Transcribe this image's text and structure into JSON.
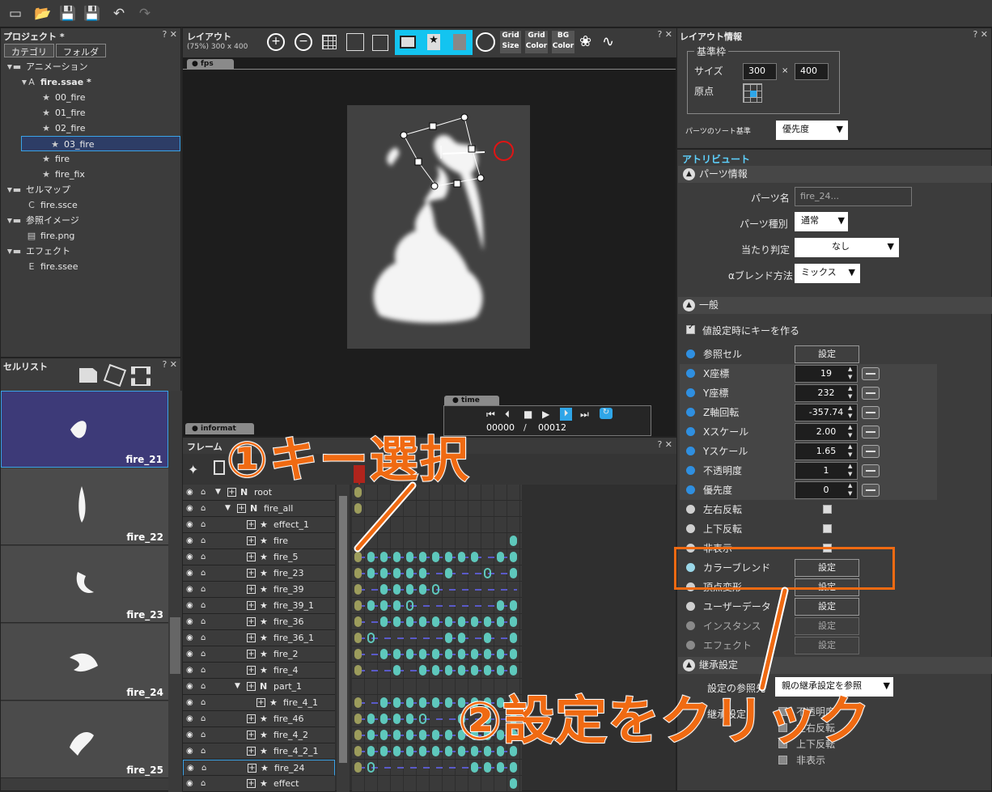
{
  "project": {
    "title": "プロジェクト *",
    "tabs": [
      "カテゴリ",
      "フォルダ"
    ],
    "tree": [
      {
        "label": "アニメーション",
        "icon": "folder-icon",
        "indent": 0,
        "expander": "▲"
      },
      {
        "label": "fire.ssae *",
        "icon": "animation-file-icon",
        "indent": 1,
        "expander": "▲"
      },
      {
        "label": "00_fire",
        "icon": "running-figure-icon",
        "indent": 2
      },
      {
        "label": "01_fire",
        "icon": "running-figure-icon",
        "indent": 2
      },
      {
        "label": "02_fire",
        "icon": "running-figure-icon",
        "indent": 2
      },
      {
        "label": "03_fire",
        "icon": "running-figure-icon",
        "indent": 2,
        "selected": true
      },
      {
        "label": "fire",
        "icon": "running-figure-icon",
        "indent": 2
      },
      {
        "label": "fire_fix",
        "icon": "running-figure-icon",
        "indent": 2
      },
      {
        "label": "セルマップ",
        "icon": "folder-icon",
        "indent": 0,
        "expander": "▲"
      },
      {
        "label": "fire.ssce",
        "icon": "cellmap-file-icon",
        "indent": 1
      },
      {
        "label": "参照イメージ",
        "icon": "folder-icon",
        "indent": 0,
        "expander": "▲"
      },
      {
        "label": "fire.png",
        "icon": "image-file-icon",
        "indent": 1
      },
      {
        "label": "エフェクト",
        "icon": "folder-icon",
        "indent": 0,
        "expander": "▲"
      },
      {
        "label": "fire.ssee",
        "icon": "effect-file-icon",
        "indent": 1
      }
    ]
  },
  "cell_list": {
    "title": "セルリスト",
    "cells": [
      "fire_21",
      "fire_22",
      "fire_23",
      "fire_24",
      "fire_25"
    ]
  },
  "layout": {
    "title": "レイアウト",
    "subtitle": "(75%) 300 x 400",
    "fps_label": "fps",
    "time_label": "time",
    "info_label": "informat",
    "tools": [
      "Grid Size",
      "Grid Color",
      "BG Color"
    ],
    "frame_current": "00000",
    "frame_sep": "/",
    "frame_total": "00012"
  },
  "timeline": {
    "title": "フレーム",
    "rows": [
      {
        "name": "root",
        "type": "N",
        "indent": 0,
        "keys": [
          0
        ]
      },
      {
        "name": "fire_all",
        "type": "N",
        "indent": 1,
        "keys": [
          0
        ]
      },
      {
        "name": "effect_1",
        "type": "effect",
        "indent": 2,
        "keys": []
      },
      {
        "name": "fire",
        "type": "part",
        "indent": 2,
        "keys": [
          12
        ]
      },
      {
        "name": "fire_5",
        "type": "part",
        "indent": 2,
        "keys": [
          0,
          1,
          2,
          3,
          4,
          5,
          6,
          7,
          8,
          9,
          11,
          12
        ]
      },
      {
        "name": "fire_23",
        "type": "part",
        "indent": 2,
        "keys": [
          0,
          1,
          2,
          3,
          4,
          5,
          7,
          10,
          12
        ]
      },
      {
        "name": "fire_39",
        "type": "part",
        "indent": 2,
        "keys": [
          0,
          2,
          3,
          4,
          5,
          6
        ]
      },
      {
        "name": "fire_39_1",
        "type": "part",
        "indent": 2,
        "keys": [
          0,
          1,
          2,
          3,
          4,
          11,
          12
        ]
      },
      {
        "name": "fire_36",
        "type": "part",
        "indent": 2,
        "keys": [
          0,
          2,
          3,
          4,
          5,
          6,
          7,
          8,
          9,
          10,
          11,
          12
        ]
      },
      {
        "name": "fire_36_1",
        "type": "part",
        "indent": 2,
        "keys": [
          0,
          1,
          7,
          8,
          10,
          12
        ]
      },
      {
        "name": "fire_2",
        "type": "part",
        "indent": 2,
        "keys": [
          0,
          2,
          3,
          4,
          5,
          6,
          7,
          8,
          9,
          10,
          11,
          12
        ]
      },
      {
        "name": "fire_4",
        "type": "part",
        "indent": 2,
        "keys": [
          0,
          3,
          5,
          6,
          7,
          8,
          9,
          10,
          11,
          12
        ]
      },
      {
        "name": "part_1",
        "type": "N",
        "indent": 2,
        "keys": []
      },
      {
        "name": "fire_4_1",
        "type": "part",
        "indent": 3,
        "keys": [
          0,
          2,
          3,
          4,
          5,
          6,
          7,
          8,
          9,
          10,
          11,
          12
        ]
      },
      {
        "name": "fire_46",
        "type": "part",
        "indent": 2,
        "keys": [
          0,
          1,
          2,
          3,
          4,
          5,
          8,
          10,
          12
        ]
      },
      {
        "name": "fire_4_2",
        "type": "part",
        "indent": 2,
        "keys": [
          0,
          1,
          2,
          3,
          4,
          5,
          6,
          7,
          8,
          9,
          10,
          11,
          12
        ]
      },
      {
        "name": "fire_4_2_1",
        "type": "part",
        "indent": 2,
        "keys": [
          0,
          1,
          2,
          3,
          4,
          5,
          6,
          7,
          8,
          9,
          10,
          11,
          12
        ]
      },
      {
        "name": "fire_24",
        "type": "part",
        "indent": 2,
        "keys": [
          0,
          1,
          9,
          10,
          11,
          12
        ],
        "selected": true
      },
      {
        "name": "effect",
        "type": "part",
        "indent": 2,
        "keys": [
          12
        ]
      }
    ]
  },
  "layout_info": {
    "title": "レイアウト情報",
    "frame_group": "基準枠",
    "size_label": "サイズ",
    "width": "300",
    "times": "×",
    "height": "400",
    "origin_label": "原点",
    "sort_label": "パーツのソート基準",
    "sort_value": "優先度"
  },
  "attributes": {
    "title": "アトリビュート",
    "parts_section": "パーツ情報",
    "part_name_label": "パーツ名",
    "part_name_value": "fire_24...",
    "part_type_label": "パーツ種別",
    "part_type_value": "通常",
    "hit_label": "当たり判定",
    "hit_value": "なし",
    "blend_label": "αブレンド方法",
    "blend_value": "ミックス",
    "general_section": "一般",
    "auto_key_label": "値設定時にキーを作る",
    "rows": [
      {
        "label": "参照セル",
        "dot": "#2f8fe0",
        "kind": "button",
        "value": "設定"
      },
      {
        "label": "X座標",
        "dot": "#2f8fe0",
        "kind": "spin",
        "value": "19"
      },
      {
        "label": "Y座標",
        "dot": "#2f8fe0",
        "kind": "spin",
        "value": "232"
      },
      {
        "label": "Z軸回転",
        "dot": "#2f8fe0",
        "kind": "spin",
        "value": "-357.74"
      },
      {
        "label": "Xスケール",
        "dot": "#2f8fe0",
        "kind": "spin",
        "value": "2.00"
      },
      {
        "label": "Yスケール",
        "dot": "#2f8fe0",
        "kind": "spin",
        "value": "1.65"
      },
      {
        "label": "不透明度",
        "dot": "#2f8fe0",
        "kind": "spin",
        "value": "1"
      },
      {
        "label": "優先度",
        "dot": "#2f8fe0",
        "kind": "spin",
        "value": "0"
      },
      {
        "label": "左右反転",
        "dot": "#cfcfcf",
        "kind": "check",
        "value": ""
      },
      {
        "label": "上下反転",
        "dot": "#cfcfcf",
        "kind": "check",
        "value": ""
      },
      {
        "label": "非表示",
        "dot": "#cfcfcf",
        "kind": "check",
        "value": ""
      },
      {
        "label": "カラーブレンド",
        "dot": "#9ad7e8",
        "kind": "button",
        "value": "設定"
      },
      {
        "label": "頂点変形",
        "dot": "#cfcfcf",
        "kind": "button",
        "value": "設定"
      },
      {
        "label": "ユーザーデータ",
        "dot": "#cfcfcf",
        "kind": "button",
        "value": "設定"
      },
      {
        "label": "インスタンス",
        "dot": "#8a8a8a",
        "kind": "button",
        "value": "設定"
      },
      {
        "label": "エフェクト",
        "dot": "#8a8a8a",
        "kind": "button",
        "value": "設定"
      }
    ],
    "inherit_section": "継承設定",
    "inherit_ref_label": "設定の参照先",
    "inherit_ref_value": "親の継承設定を参照",
    "inherit_label": "継承設定",
    "inherit_items": [
      "不透明度",
      "左右反転",
      "上下反転",
      "非表示"
    ]
  },
  "annotations": {
    "step1": "①キー選択",
    "step2": "②設定をクリック",
    "accent": "#f06a12"
  }
}
